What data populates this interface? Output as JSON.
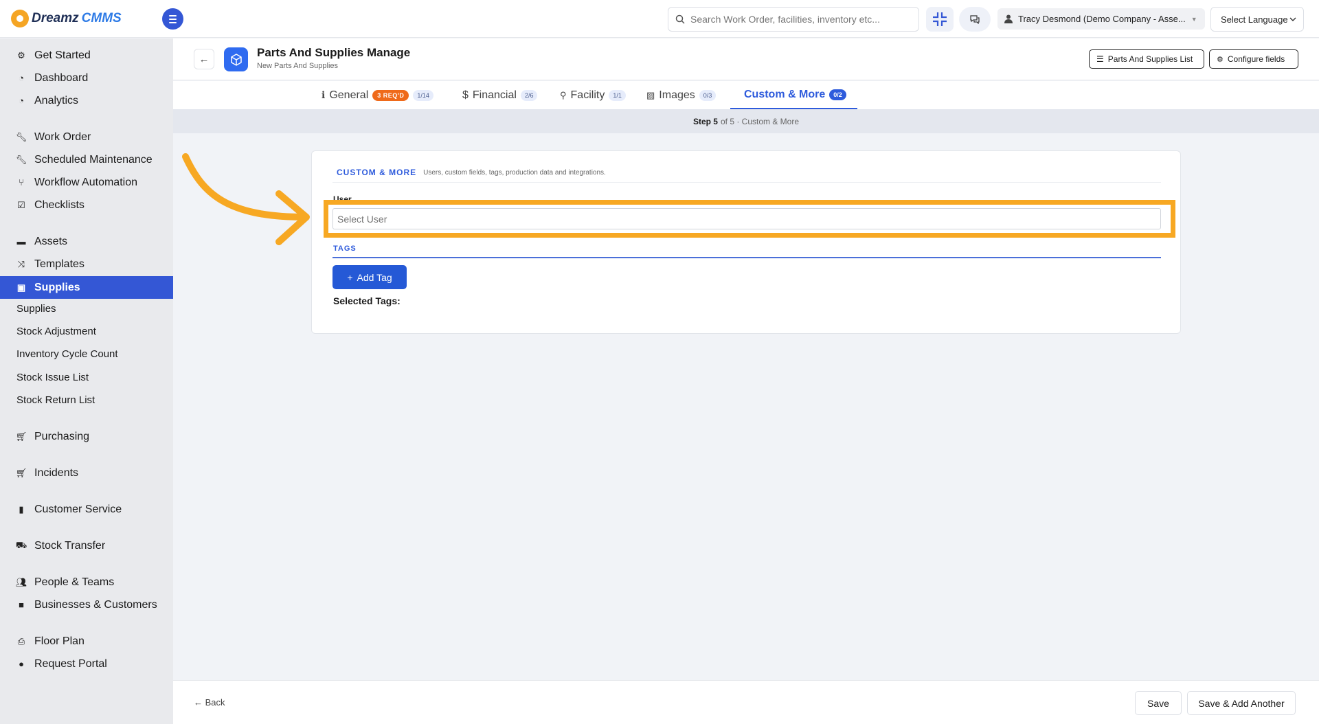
{
  "brand": {
    "name_part1": "Dreamz",
    "name_part2": "CMMS"
  },
  "header": {
    "search_placeholder": "Search Work Order, facilities, inventory etc...",
    "user": "Tracy Desmond (Demo Company - Asse...",
    "language": "Select Language"
  },
  "sidebar": {
    "items": [
      {
        "label": "Get Started",
        "icon": "gears-icon"
      },
      {
        "label": "Dashboard",
        "icon": "dashboard-icon"
      },
      {
        "label": "Analytics",
        "icon": "analytics-icon"
      },
      {
        "label": "Work Order",
        "icon": "wrench-icon"
      },
      {
        "label": "Scheduled Maintenance",
        "icon": "wrench-icon"
      },
      {
        "label": "Workflow Automation",
        "icon": "workflow-icon"
      },
      {
        "label": "Checklists",
        "icon": "checkbox-icon"
      },
      {
        "label": "Assets",
        "icon": "archive-icon"
      },
      {
        "label": "Templates",
        "icon": "shuffle-icon"
      },
      {
        "label": "Supplies",
        "icon": "briefcase-icon"
      },
      {
        "label": "Supplies",
        "icon": ""
      },
      {
        "label": "Stock Adjustment",
        "icon": ""
      },
      {
        "label": "Inventory Cycle Count",
        "icon": ""
      },
      {
        "label": "Stock Issue List",
        "icon": ""
      },
      {
        "label": "Stock Return List",
        "icon": ""
      },
      {
        "label": "Purchasing",
        "icon": "cart-icon"
      },
      {
        "label": "Incidents",
        "icon": "cart-icon"
      },
      {
        "label": "Customer Service",
        "icon": "file-icon"
      },
      {
        "label": "Stock Transfer",
        "icon": "truck-icon"
      },
      {
        "label": "People & Teams",
        "icon": "users-icon"
      },
      {
        "label": "Businesses & Customers",
        "icon": "video-icon"
      },
      {
        "label": "Floor Plan",
        "icon": "print-icon"
      },
      {
        "label": "Request Portal",
        "icon": "chat-icon"
      }
    ]
  },
  "page": {
    "title": "Parts And Supplies Manage",
    "subtitle": "New Parts And Supplies",
    "list_button": "Parts And Supplies List",
    "configure_button": "Configure fields"
  },
  "tabs": [
    {
      "label": "General",
      "required": "3 REQ'D",
      "count": "1/14"
    },
    {
      "label": "Financial",
      "count": "2/6"
    },
    {
      "label": "Facility",
      "count": "1/1"
    },
    {
      "label": "Images",
      "count": "0/3"
    },
    {
      "label": "Custom & More",
      "count": "0/2"
    }
  ],
  "step": {
    "bold": "Step 5",
    "rest": "of 5 · Custom & More"
  },
  "section": {
    "heading": "CUSTOM & MORE",
    "description": "Users, custom fields, tags, production data and integrations.",
    "user_label": "User",
    "user_placeholder": "Select User",
    "tags_heading": "TAGS",
    "add_tag": "Add Tag",
    "selected_tags": "Selected Tags:"
  },
  "footer": {
    "back": "← Back",
    "save": "Save",
    "save_add": "Save & Add Another"
  },
  "colors": {
    "primary": "#3457d5",
    "highlight": "#f7a823",
    "required": "#ef6a1a"
  }
}
